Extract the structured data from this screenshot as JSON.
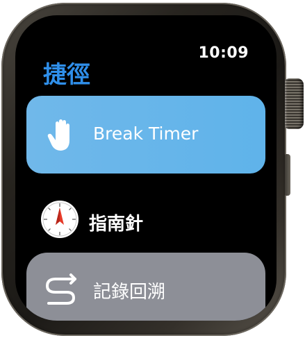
{
  "status": {
    "time": "10:09"
  },
  "header": {
    "title": "捷徑"
  },
  "shortcuts": [
    {
      "label": "Break Timer",
      "icon": "hand-icon",
      "color": "#67B6EA"
    },
    {
      "label": "指南針",
      "icon": "compass-icon"
    },
    {
      "label": "記錄回溯",
      "icon": "backtrack-icon",
      "color": "#8D8F97"
    }
  ],
  "colors": {
    "accent": "#2F8FEA",
    "background": "#000000"
  }
}
